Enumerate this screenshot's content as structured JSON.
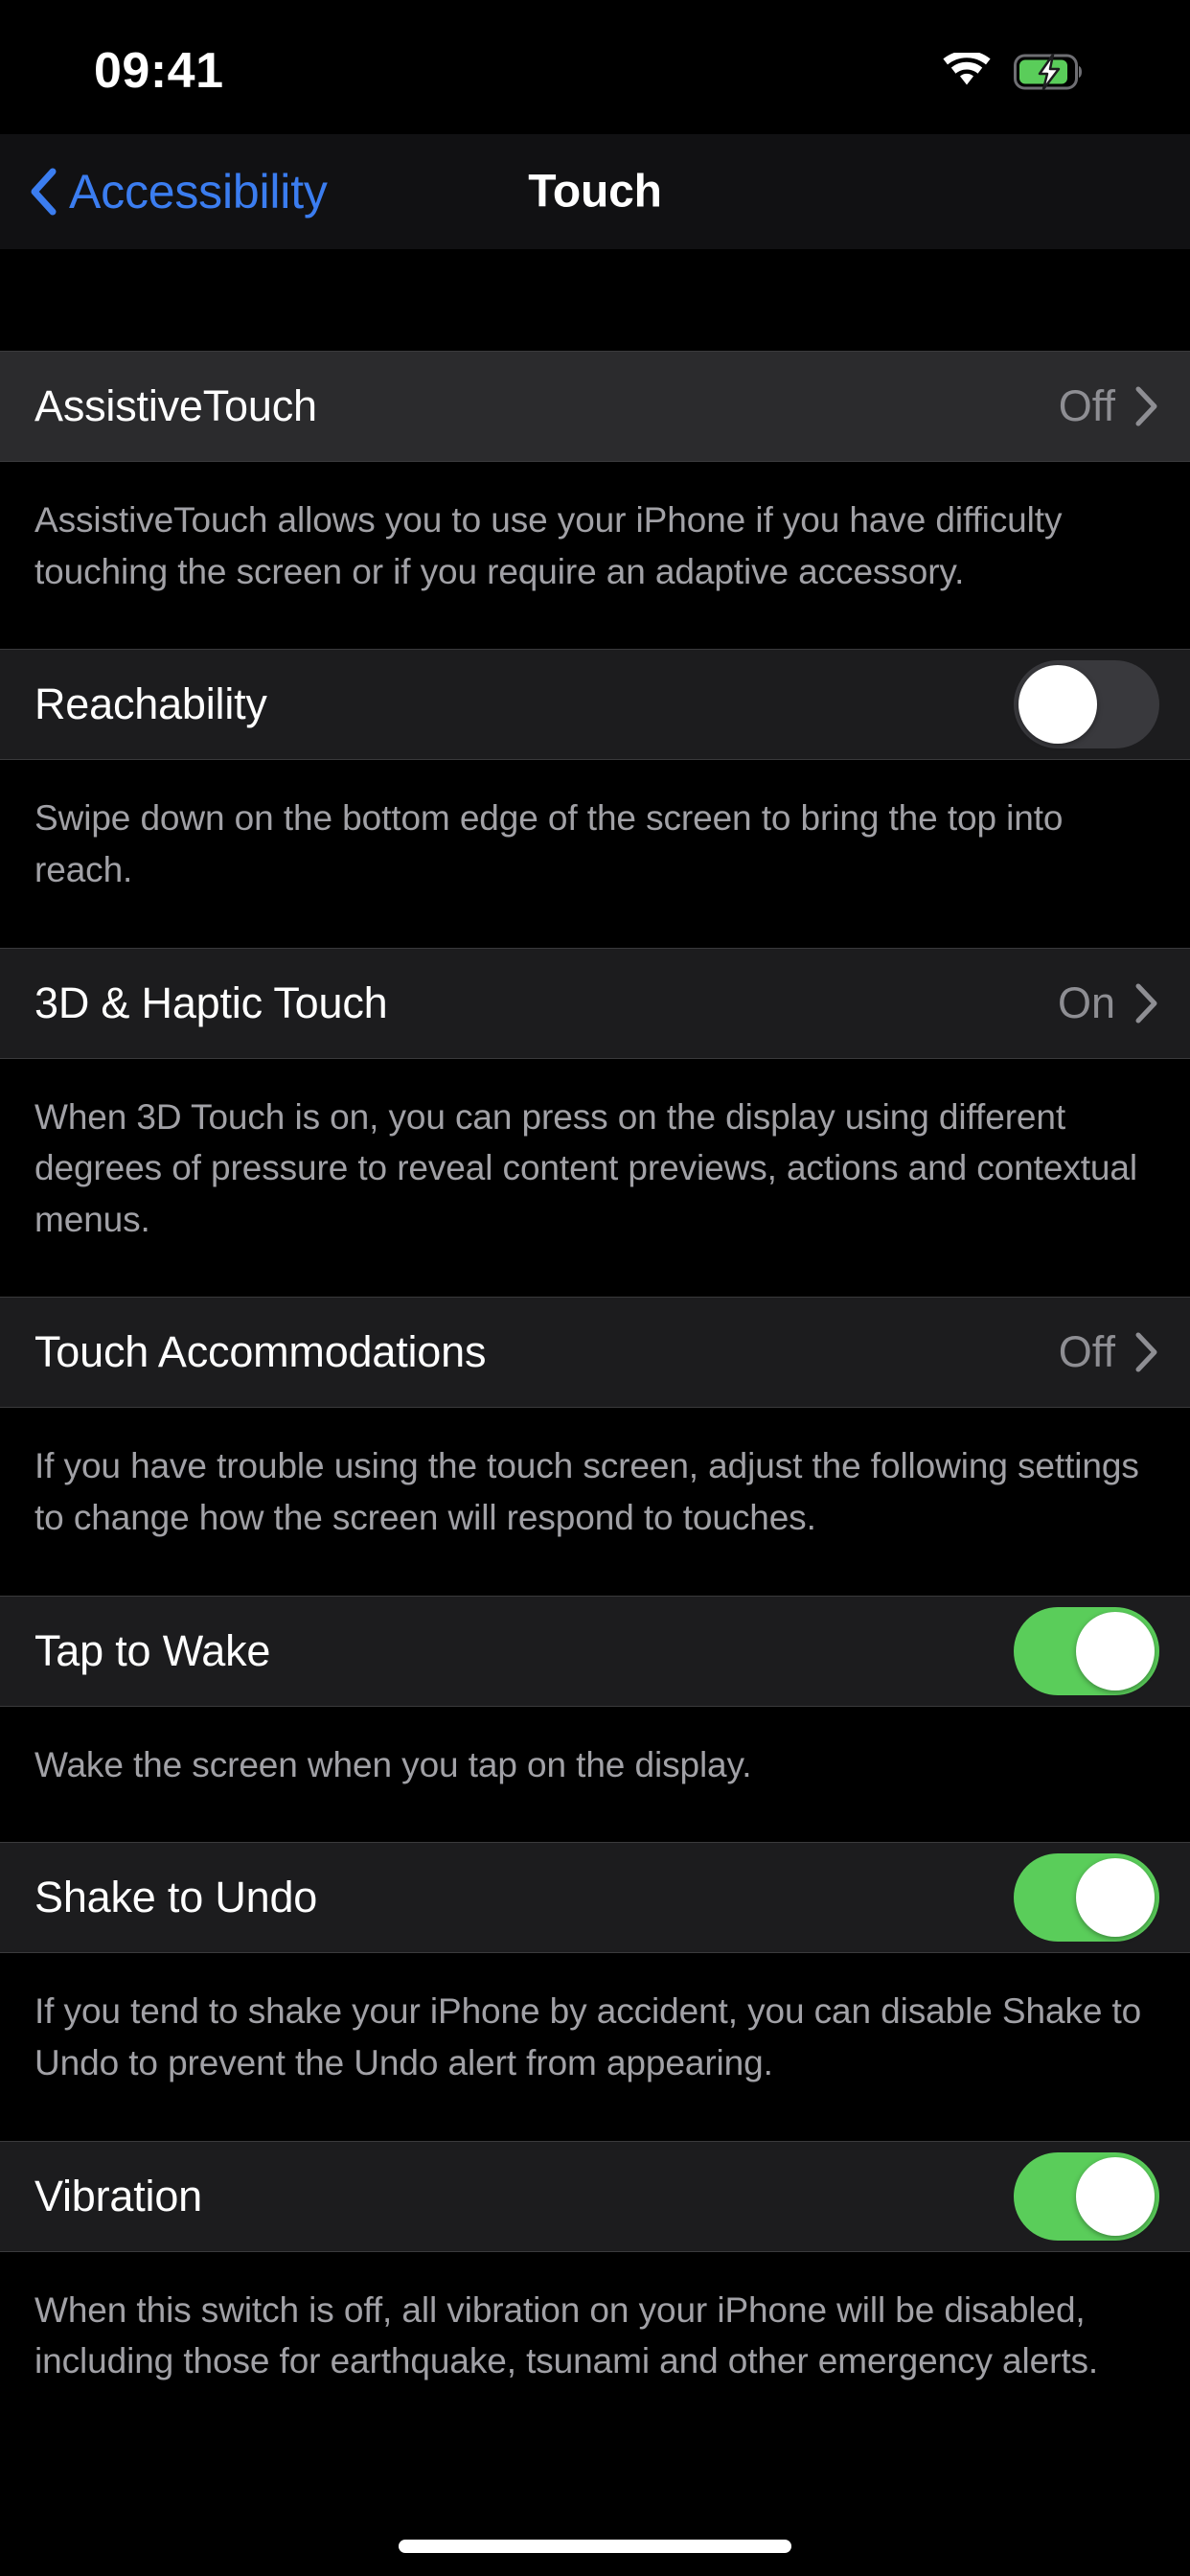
{
  "status_bar": {
    "time": "09:41",
    "wifi_icon": "wifi-icon",
    "battery_icon": "battery-charging-icon",
    "battery_color": "#5ACD5A"
  },
  "nav_bar": {
    "back_icon": "chevron-left-icon",
    "back_label": "Accessibility",
    "title": "Touch",
    "tint_color": "#3B7DF0"
  },
  "colors": {
    "background": "#000000",
    "cell_background": "#2B2B2D",
    "cell_background_alt": "#1C1C1E",
    "separator": "#3A3A3C",
    "primary_text": "#FFFFFF",
    "secondary_text": "#8E8E93",
    "footer_text": "#A1A1A6",
    "toggle_on": "#5ACD5A",
    "toggle_off": "#39393D"
  },
  "sections": [
    {
      "title": "AssistiveTouch",
      "control": "disclosure",
      "value": "Off",
      "disclosure_icon": "chevron-right-icon",
      "footer": "AssistiveTouch allows you to use your iPhone if you have difficulty touching the screen or if you require an adaptive accessory."
    },
    {
      "title": "Reachability",
      "control": "toggle",
      "toggle_state": "off",
      "footer": "Swipe down on the bottom edge of the screen to bring the top into reach."
    },
    {
      "title": "3D & Haptic Touch",
      "control": "disclosure",
      "value": "On",
      "disclosure_icon": "chevron-right-icon",
      "footer": "When 3D Touch is on, you can press on the display using different degrees of pressure to reveal content previews, actions and contextual menus."
    },
    {
      "title": "Touch Accommodations",
      "control": "disclosure",
      "value": "Off",
      "disclosure_icon": "chevron-right-icon",
      "footer": "If you have trouble using the touch screen, adjust the following settings to change how the screen will respond to touches."
    },
    {
      "title": "Tap to Wake",
      "control": "toggle",
      "toggle_state": "on",
      "footer": "Wake the screen when you tap on the display."
    },
    {
      "title": "Shake to Undo",
      "control": "toggle",
      "toggle_state": "on",
      "footer": "If you tend to shake your iPhone by accident, you can disable Shake to Undo to prevent the Undo alert from appearing."
    },
    {
      "title": "Vibration",
      "control": "toggle",
      "toggle_state": "on",
      "footer": "When this switch is off, all vibration on your iPhone will be disabled, including those for earthquake, tsunami and other emergency alerts."
    }
  ],
  "home_indicator": "home-indicator"
}
